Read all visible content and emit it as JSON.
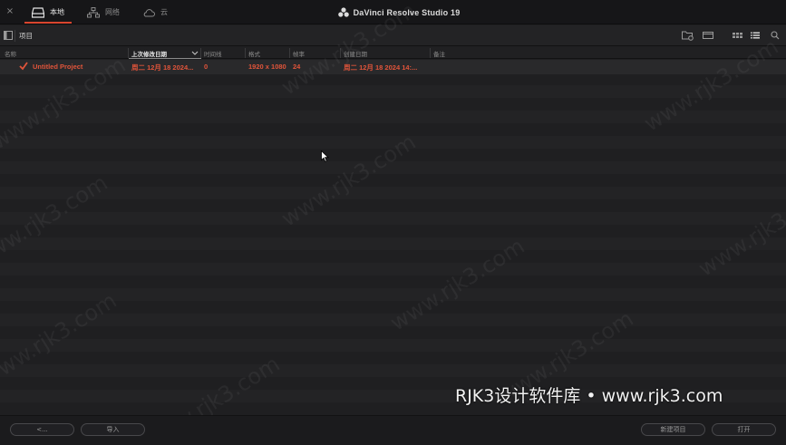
{
  "window": {
    "close_label": "×",
    "app_title": "DaVinci Resolve Studio 19"
  },
  "tabs": [
    {
      "label": "本地",
      "icon": "drive-icon",
      "active": true
    },
    {
      "label": "网络",
      "icon": "network-icon",
      "active": false
    },
    {
      "label": "云",
      "icon": "cloud-icon",
      "active": false
    }
  ],
  "toolbar": {
    "breadcrumb": "项目"
  },
  "columns": [
    {
      "label": "名称",
      "sorted": false
    },
    {
      "label": "上次修改日期",
      "sorted": true
    },
    {
      "label": "时间线",
      "sorted": false
    },
    {
      "label": "格式",
      "sorted": false
    },
    {
      "label": "帧率",
      "sorted": false
    },
    {
      "label": "创建日期",
      "sorted": false
    },
    {
      "label": "备注",
      "sorted": false
    }
  ],
  "project": {
    "name": "Untitled Project",
    "modified": "周二 12月 18 2024...",
    "timelines": "0",
    "format": "1920 x 1080",
    "fps": "24",
    "created": "周二 12月 18 2024 14:..."
  },
  "buttons": {
    "back": "<...",
    "import": "导入",
    "new_project": "新建项目",
    "open": "打开"
  },
  "watermark": {
    "text": "www.rjk3.com",
    "brand": "RJK3设计软件库 • www.rjk3.com"
  },
  "colors": {
    "accent": "#d9452e",
    "project_text": "#e0543a"
  }
}
